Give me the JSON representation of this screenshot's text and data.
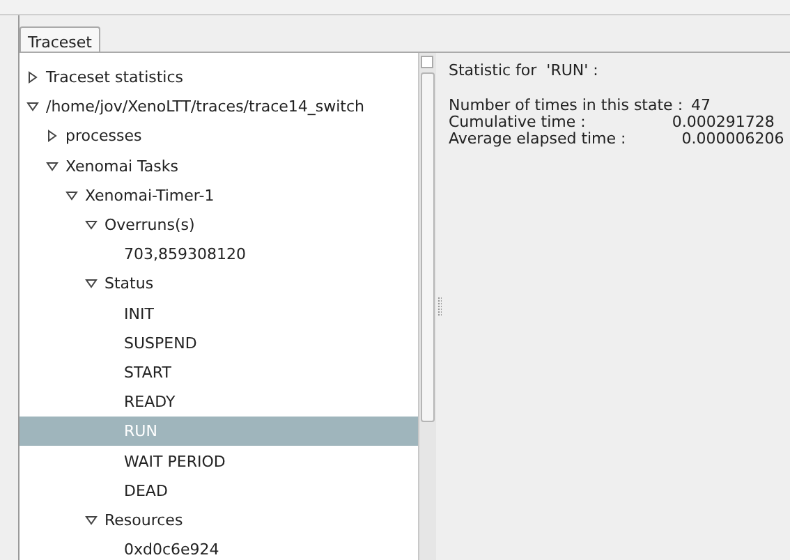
{
  "tabs": [
    {
      "label": "Traceset",
      "selected": true
    }
  ],
  "tree": [
    {
      "label": "Traceset statistics",
      "expanded": false,
      "selected": false
    },
    {
      "label": "/home/jov/XenoLTT/traces/trace14_switch",
      "expanded": true,
      "selected": false,
      "children": [
        {
          "label": "processes",
          "expanded": false,
          "selected": false
        },
        {
          "label": "Xenomai Tasks",
          "expanded": true,
          "selected": false,
          "children": [
            {
              "label": "Xenomai-Timer-1",
              "expanded": true,
              "selected": false,
              "children": [
                {
                  "label": "Overruns(s)",
                  "expanded": true,
                  "selected": false,
                  "children": [
                    {
                      "label": "703,859308120",
                      "selected": false
                    }
                  ]
                },
                {
                  "label": "Status",
                  "expanded": true,
                  "selected": false,
                  "children": [
                    {
                      "label": "INIT",
                      "selected": false
                    },
                    {
                      "label": "SUSPEND",
                      "selected": false
                    },
                    {
                      "label": "START",
                      "selected": false
                    },
                    {
                      "label": "READY",
                      "selected": false
                    },
                    {
                      "label": "RUN",
                      "selected": true
                    },
                    {
                      "label": "WAIT PERIOD",
                      "selected": false
                    },
                    {
                      "label": "DEAD",
                      "selected": false
                    }
                  ]
                },
                {
                  "label": "Resources",
                  "expanded": true,
                  "selected": false,
                  "children": [
                    {
                      "label": "0xd0c6e924",
                      "selected": false
                    }
                  ]
                }
              ]
            }
          ]
        }
      ]
    }
  ],
  "statistics": {
    "heading": "Statistic for  'RUN' :",
    "lines": [
      {
        "label": "Number of times in this state :",
        "value": "47"
      },
      {
        "label": "Cumulative time :",
        "value": "0.000291728"
      },
      {
        "label": "Average elapsed time :",
        "value": "0.000006206"
      }
    ]
  }
}
